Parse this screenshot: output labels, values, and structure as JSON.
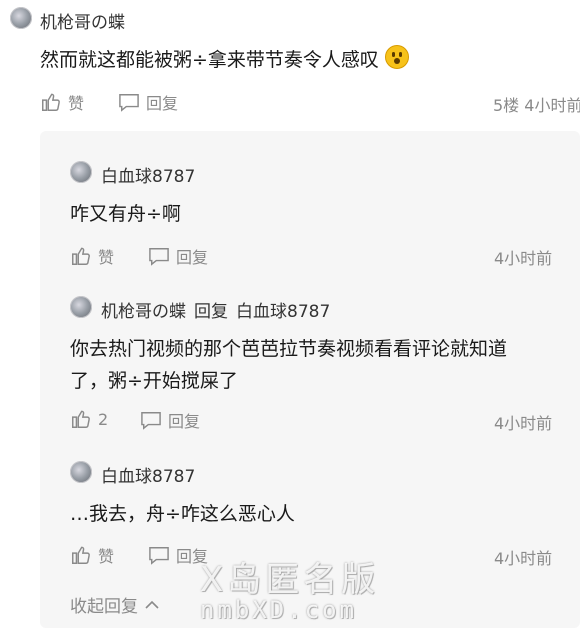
{
  "top_comment": {
    "username": "机枪哥の蝶",
    "text": "然而就这都能被粥÷拿来带节奏令人感叹",
    "like_label": "赞",
    "reply_label": "回复",
    "meta": "5楼 4小时前"
  },
  "replies": [
    {
      "username": "白血球8787",
      "text": "咋又有舟÷啊",
      "like_label": "赞",
      "reply_label": "回复",
      "time": "4小时前"
    },
    {
      "username": "机枪哥の蝶",
      "reply_word": "回复",
      "reply_to": "白血球8787",
      "text_line1": "你去热门视频的那个芭芭拉节奏视频看看评论就知道",
      "text_line2": "了，粥÷开始搅屎了",
      "like_count": "2",
      "reply_label": "回复",
      "time": "4小时前"
    },
    {
      "username": "白血球8787",
      "text": "…我去，舟÷咋这么恶心人",
      "like_label": "赞",
      "reply_label": "回复",
      "time": "4小时前"
    }
  ],
  "collapse_label": "收起回复",
  "watermark": {
    "line1": "X岛匿名版",
    "line2": "nmbXD.com"
  }
}
